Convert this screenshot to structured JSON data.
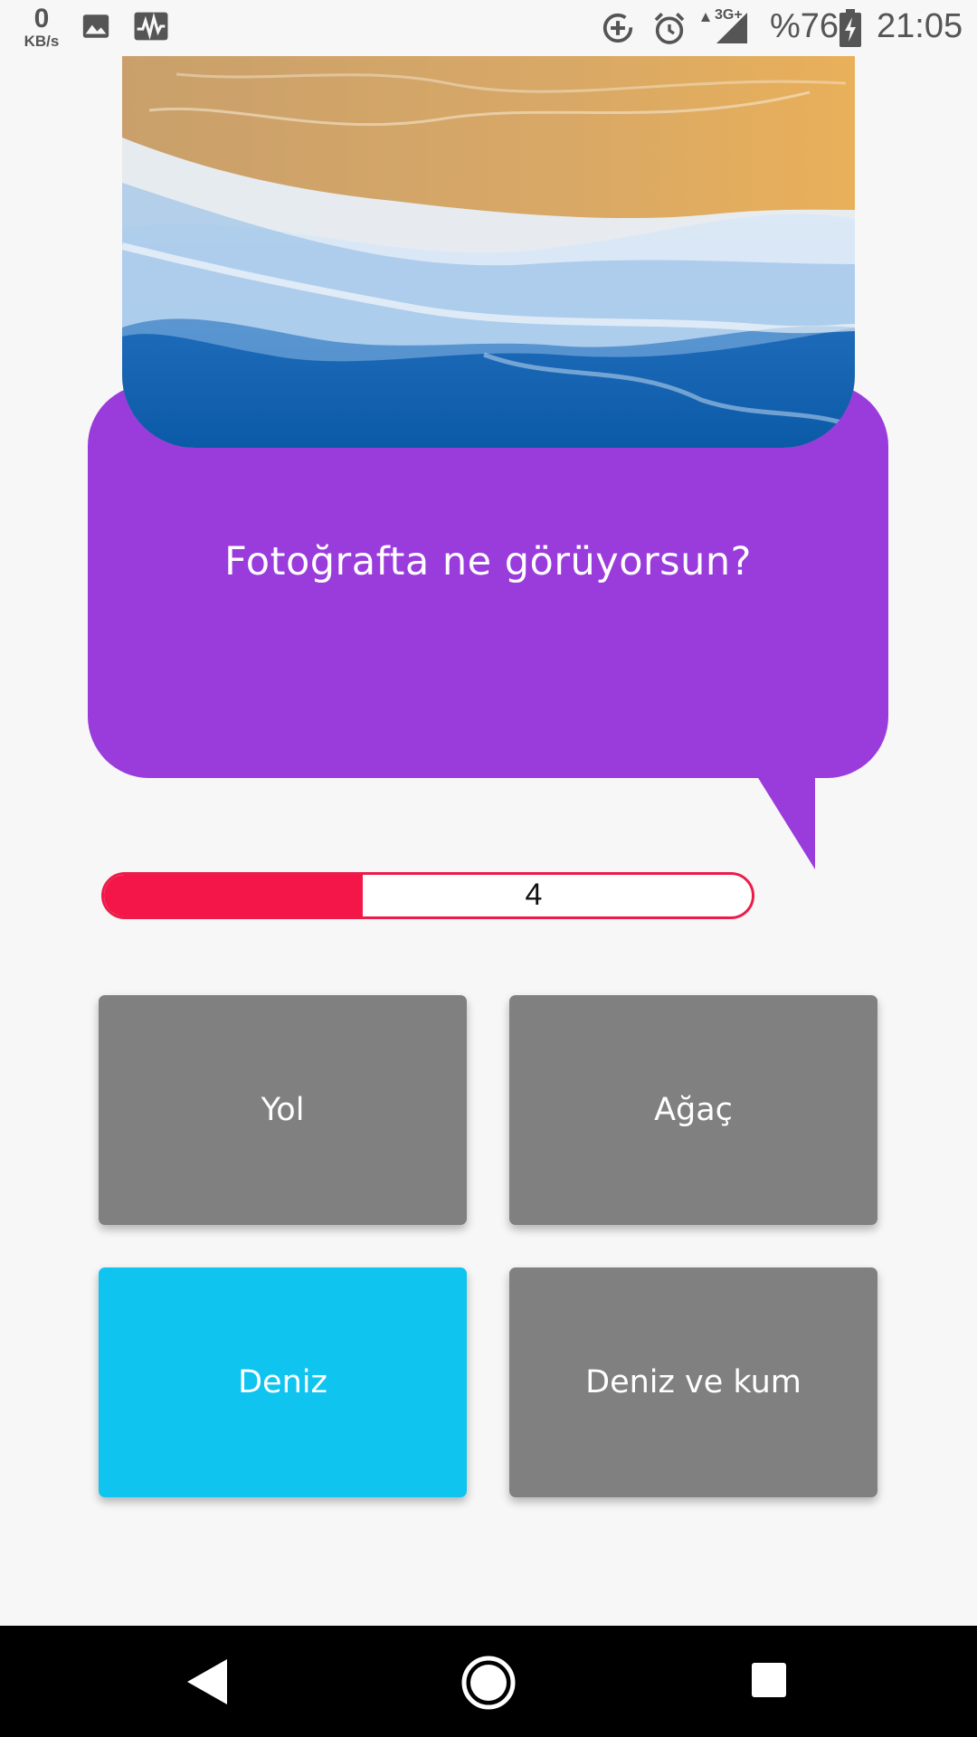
{
  "status_bar": {
    "net_speed_value": "0",
    "net_speed_unit": "KB/s",
    "network_type": "3G+",
    "battery": "%76",
    "time": "21:05",
    "icons": [
      "image-icon",
      "activity-icon",
      "data-saver-icon",
      "alarm-icon",
      "signal-icon",
      "battery-charging-icon"
    ]
  },
  "question": {
    "image_alt": "beach-waves-photo",
    "text": "Fotoğrafta ne görüyorsun?"
  },
  "timer": {
    "value": "4",
    "progress": 0.4,
    "color": "#f41649"
  },
  "answers": [
    {
      "label": "Yol",
      "selected": false
    },
    {
      "label": "Ağaç",
      "selected": false
    },
    {
      "label": "Deniz",
      "selected": true
    },
    {
      "label": "Deniz ve kum",
      "selected": false
    }
  ],
  "colors": {
    "bubble": "#9a3bdc",
    "answer_default": "#808080",
    "answer_selected": "#10c4f0",
    "timer_border": "#ec1c4a"
  },
  "nav_bar": {
    "icons": [
      "back-icon",
      "home-icon",
      "recents-icon"
    ]
  }
}
